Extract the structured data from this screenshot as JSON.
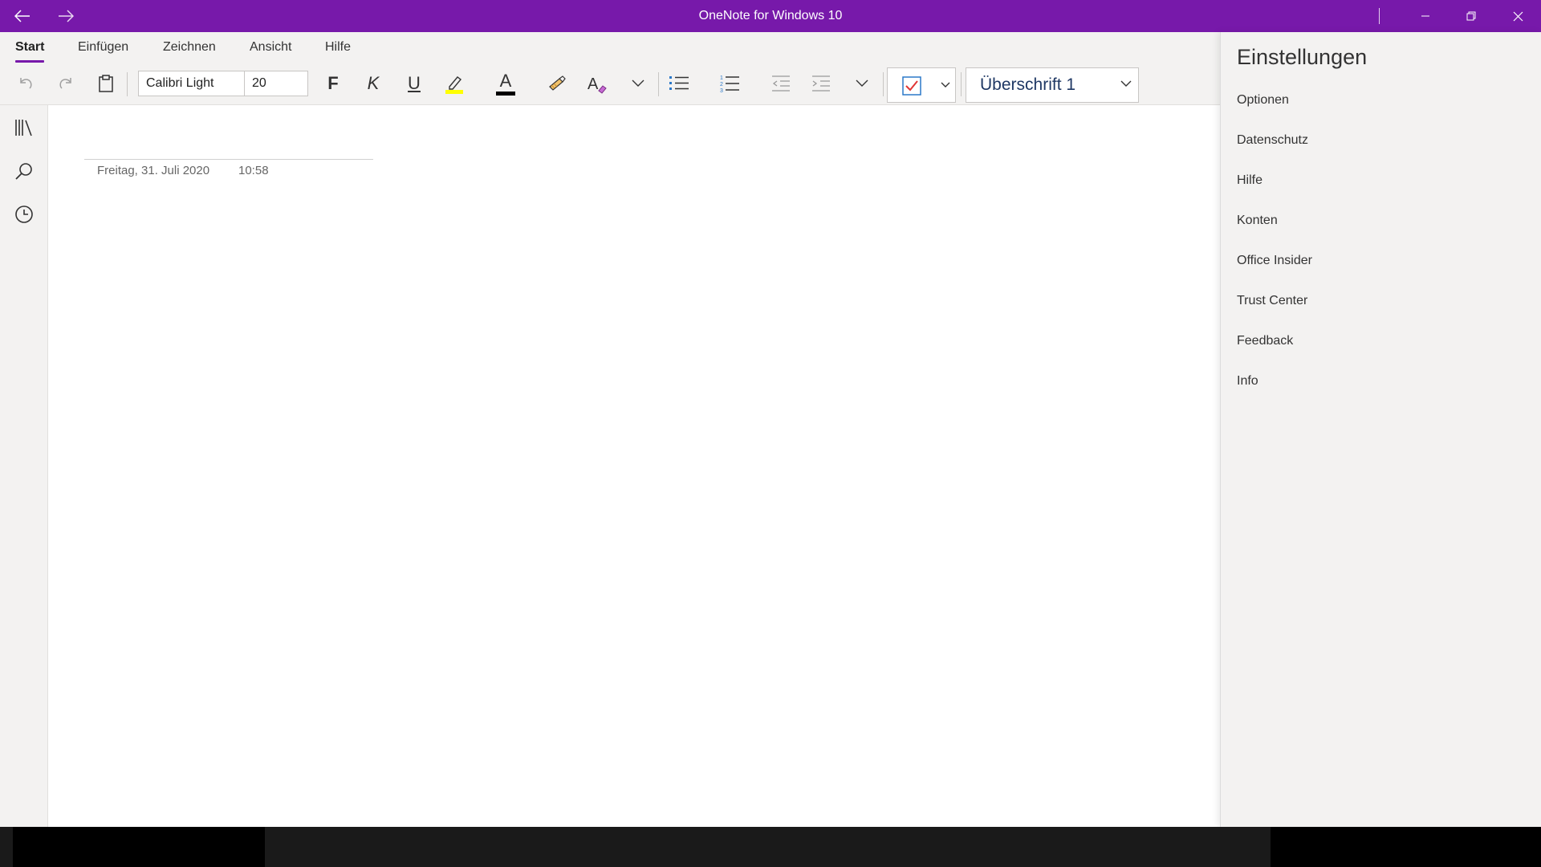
{
  "window": {
    "title": "OneNote for Windows 10",
    "accent_color": "#7719aa",
    "icons": {
      "back": "arrow-left-icon",
      "forward": "arrow-right-icon",
      "minimize": "minimize-icon",
      "restore": "restore-icon",
      "close": "close-icon"
    }
  },
  "ribbon": {
    "tabs": [
      {
        "label": "Start",
        "active": true
      },
      {
        "label": "Einfügen",
        "active": false
      },
      {
        "label": "Zeichnen",
        "active": false
      },
      {
        "label": "Ansicht",
        "active": false
      },
      {
        "label": "Hilfe",
        "active": false
      }
    ],
    "toolbar": {
      "font_name": "Calibri Light",
      "font_size": "20",
      "bold_label": "F",
      "italic_label": "K",
      "underline_label": "U",
      "font_color_label": "A",
      "style_value": "Überschrift 1",
      "highlight_color": "#ffff00",
      "font_color": "#000000",
      "tag_check_color": "#e03535",
      "icons": [
        "undo-icon",
        "redo-icon",
        "clipboard-icon",
        "highlighter-icon",
        "format-painter-icon",
        "clear-formatting-icon",
        "bullet-list-icon",
        "numbered-list-icon",
        "decrease-indent-icon",
        "increase-indent-icon",
        "todo-tag-icon",
        "chevron-down-icon"
      ]
    }
  },
  "leftnav": {
    "icons": [
      "notebooks-icon",
      "search-icon",
      "recent-icon"
    ]
  },
  "page": {
    "date": "Freitag, 31. Juli 2020",
    "time": "10:58"
  },
  "settings": {
    "title": "Einstellungen",
    "items": [
      "Optionen",
      "Datenschutz",
      "Hilfe",
      "Konten",
      "Office Insider",
      "Trust Center",
      "Feedback",
      "Info"
    ]
  }
}
